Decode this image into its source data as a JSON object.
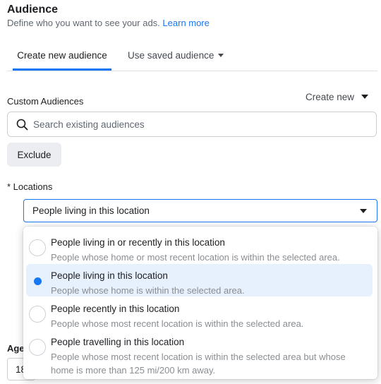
{
  "header": {
    "title": "Audience",
    "subtitle": "Define who you want to see your ads.",
    "learn_more": "Learn more"
  },
  "tabs": [
    {
      "label": "Create new audience",
      "active": true
    },
    {
      "label": "Use saved audience",
      "active": false
    }
  ],
  "custom_audiences": {
    "label": "Custom Audiences",
    "create_new": "Create new",
    "search_placeholder": "Search existing audiences",
    "exclude_label": "Exclude"
  },
  "locations": {
    "label": "* Locations",
    "selected": "People living in this location",
    "options": [
      {
        "title": "People living in or recently in this location",
        "desc": "People whose home or most recent location is within the selected area.",
        "selected": false
      },
      {
        "title": "People living in this location",
        "desc": "People whose home is within the selected area.",
        "selected": true
      },
      {
        "title": "People recently in this location",
        "desc": "People whose most recent location is within the selected area.",
        "selected": false
      },
      {
        "title": "People travelling in this location",
        "desc": "People whose most recent location is within the selected area but whose home is more than 125 mi/200 km away.",
        "selected": false
      }
    ]
  },
  "age": {
    "label": "Age",
    "min": "18"
  },
  "colors": {
    "accent": "#1877f2",
    "selected_bg": "#e7f0fd",
    "muted_text": "#606770"
  }
}
